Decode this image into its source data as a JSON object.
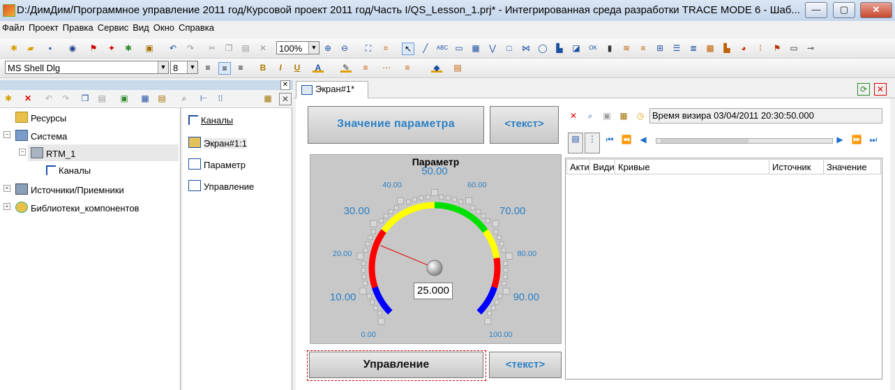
{
  "window": {
    "title": "D:/ДимДим/Программное управление 2011 год/Курсовой проект 2011 год/Часть I/QS_Lesson_1.prj* - Интегрированная среда разработки TRACE MODE 6 - Шаб...",
    "minimize": "—",
    "maximize": "▢",
    "close": "✕"
  },
  "menu": [
    "Файл",
    "Проект",
    "Правка",
    "Сервис",
    "Вид",
    "Окно",
    "Справка"
  ],
  "toolbar": {
    "zoom": "100%",
    "font_name": "MS Shell Dlg",
    "font_size": "8",
    "bold": "B",
    "italic": "I",
    "underline": "U",
    "text_color": "A",
    "abc": "ABC"
  },
  "project_tree": {
    "items": [
      {
        "label": "Ресурсы"
      },
      {
        "label": "Система"
      },
      {
        "label": "RTM_1"
      },
      {
        "label": "Каналы"
      },
      {
        "label": "Источники/Приемники"
      },
      {
        "label": "Библиотеки_компонентов"
      }
    ]
  },
  "channel_list": {
    "items": [
      {
        "label": "Каналы",
        "sub": ""
      },
      {
        "label": "Экран#1:1",
        "sub": "C"
      },
      {
        "label": "Параметр",
        "sub": "F"
      },
      {
        "label": "Управление",
        "sub": "F"
      }
    ]
  },
  "tab": {
    "label": "Экран#1*"
  },
  "screen": {
    "value_button": "Значение параметра",
    "text_button_1": "<текст>",
    "gauge_title": "Параметр",
    "gauge_value": "25.000",
    "control_button": "Управление",
    "text_button_2": "<текст>"
  },
  "gauge": {
    "value": 25,
    "min": 0,
    "max": 100,
    "major_labels": [
      "0.00",
      "10.00",
      "20.00",
      "30.00",
      "40.00",
      "50.00",
      "60.00",
      "70.00",
      "80.00",
      "90.00",
      "100.00"
    ],
    "zones": [
      {
        "from": 0,
        "to": 10,
        "color": "#0000ff"
      },
      {
        "from": 10,
        "to": 30,
        "color": "#ff0000"
      },
      {
        "from": 30,
        "to": 50,
        "color": "#ffff00"
      },
      {
        "from": 50,
        "to": 70,
        "color": "#00e000"
      },
      {
        "from": 70,
        "to": 80,
        "color": "#ffff00"
      },
      {
        "from": 80,
        "to": 90,
        "color": "#ff0000"
      },
      {
        "from": 90,
        "to": 100,
        "color": "#0000ff"
      }
    ]
  },
  "trend": {
    "cursor_time": "Время визира 03/04/2011 20:30:50.000",
    "columns": [
      "Акти",
      "Види",
      "Кривые",
      "Источник",
      "Значение"
    ]
  },
  "colors": {
    "accent": "#1e6fb8",
    "gauge_label": "#2a7fc4",
    "panel_grey": "#c8c8c8"
  }
}
